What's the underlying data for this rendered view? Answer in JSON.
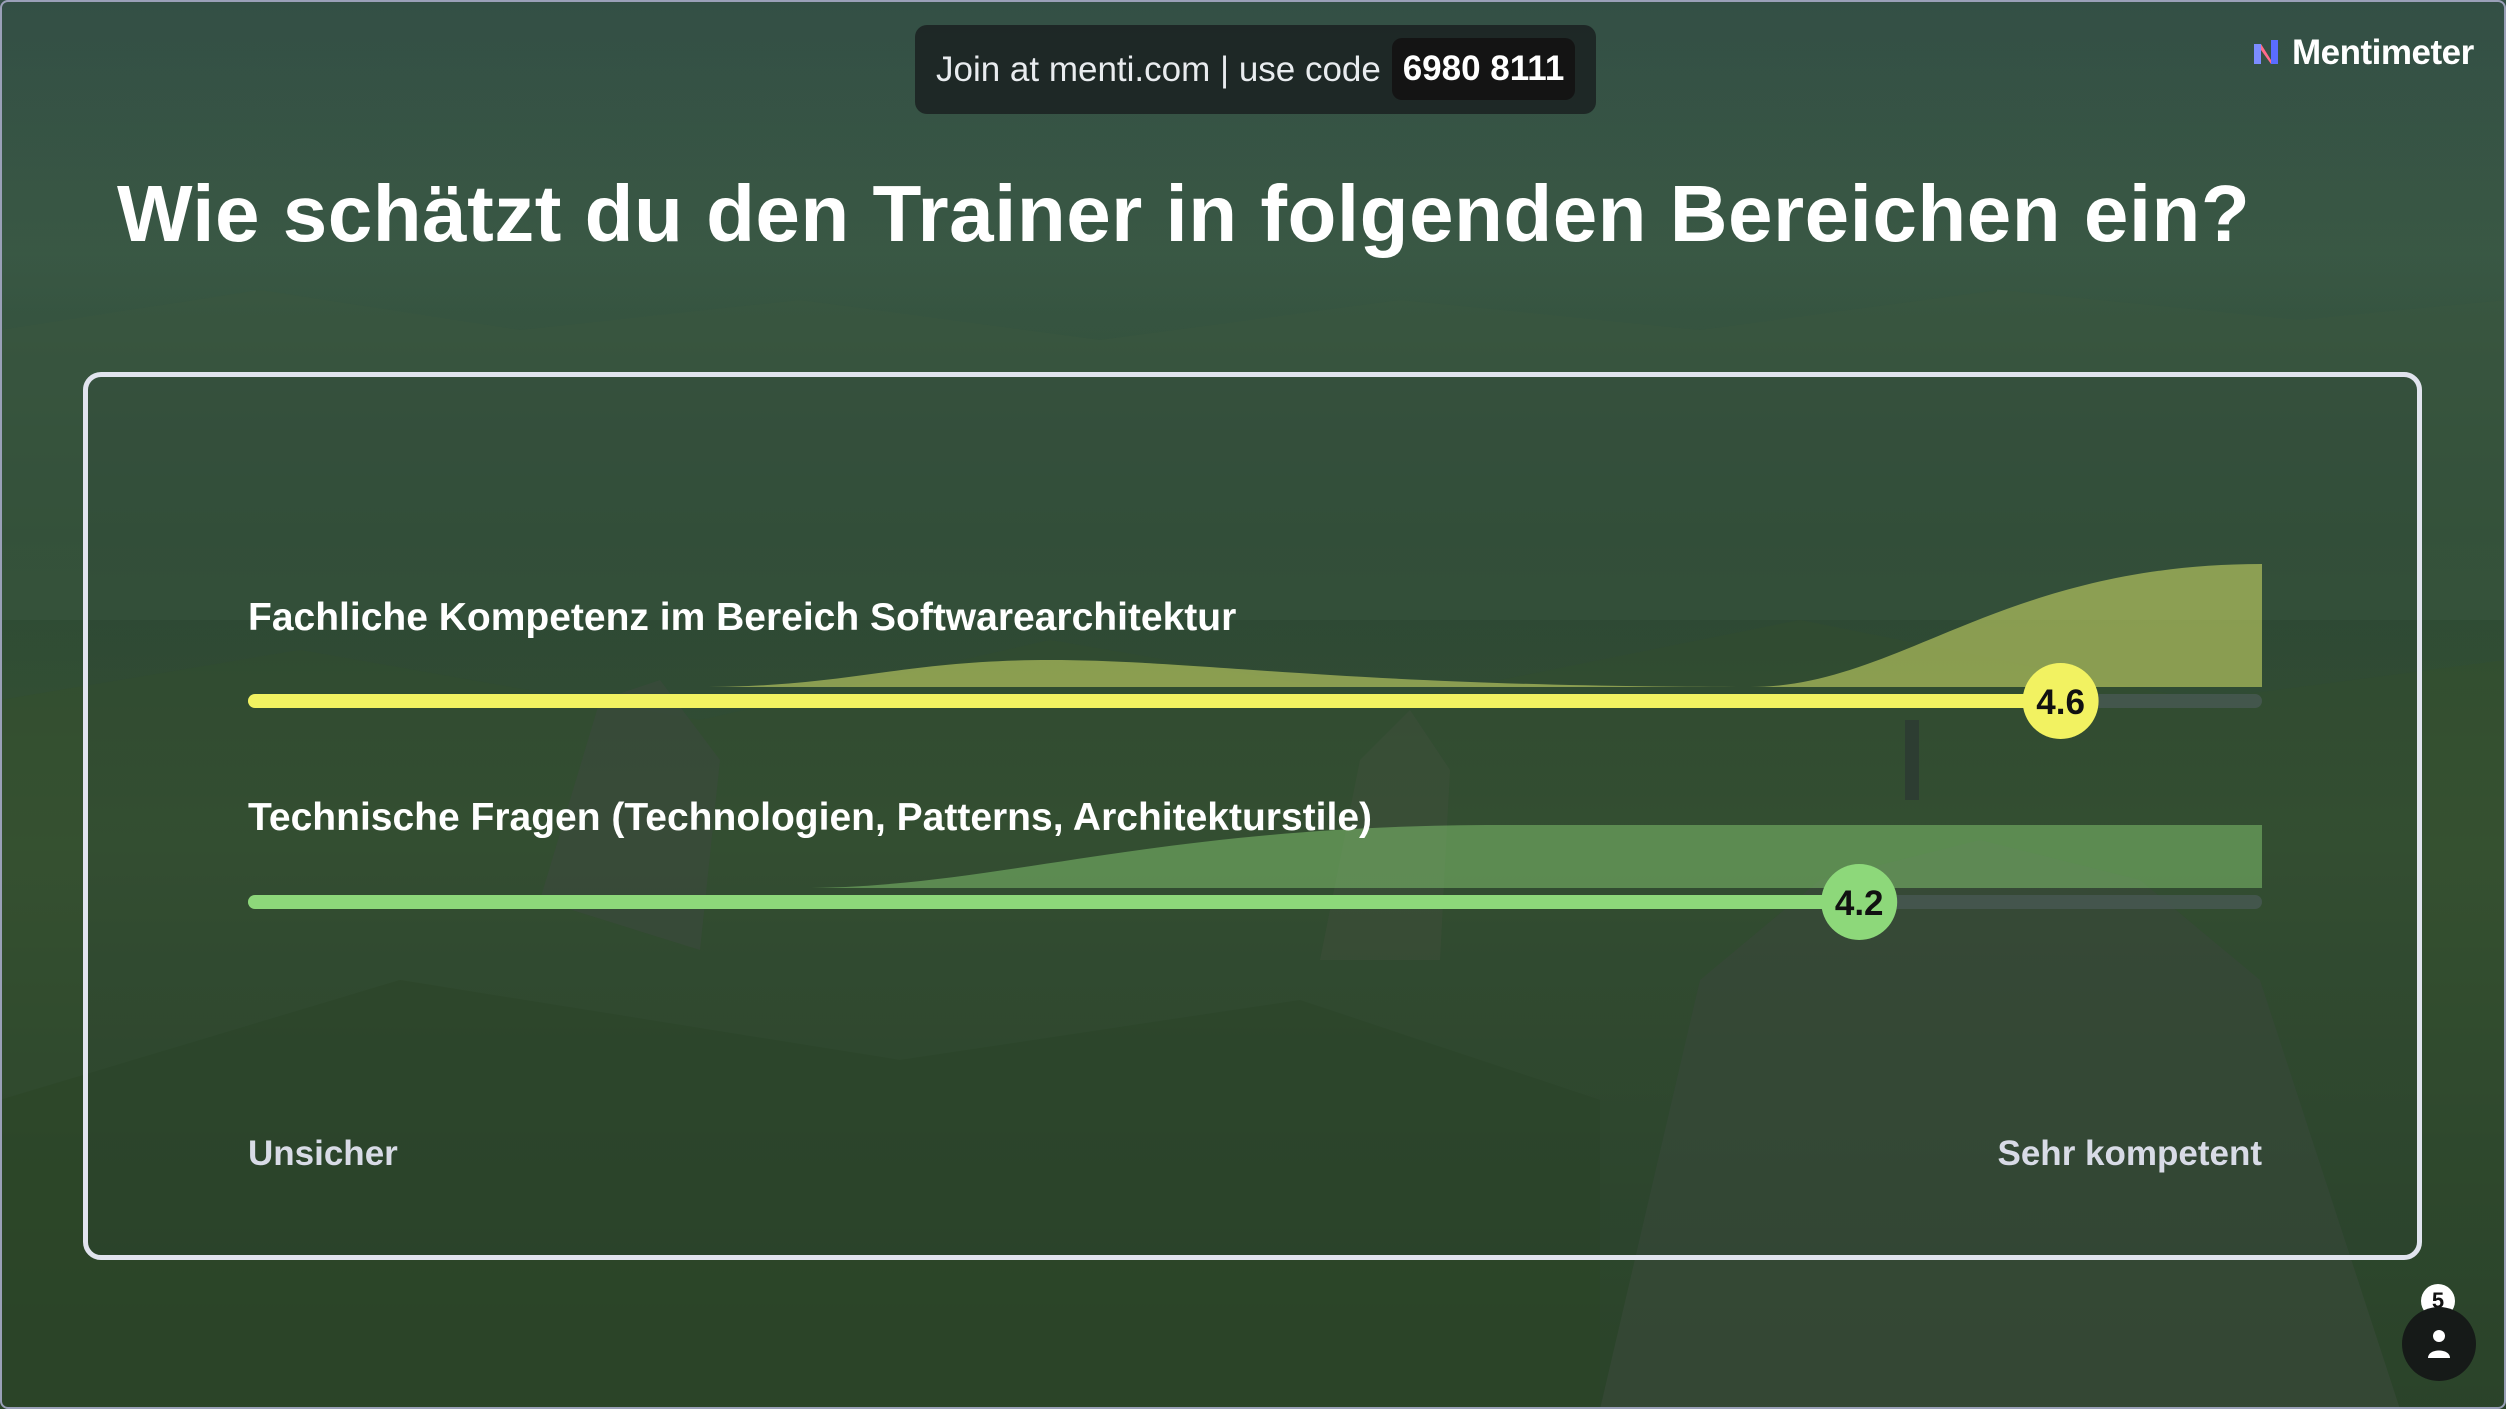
{
  "join": {
    "text": "Join at menti.com | use code",
    "code": "6980 8111"
  },
  "brand": {
    "name": "Mentimeter",
    "icon": "mentimeter-logo-icon"
  },
  "question": "Wie schätzt du den Trainer in folgenden Bereichen ein?",
  "scale": {
    "min_label": "Unsicher",
    "max_label": "Sehr kompetent",
    "min": 1,
    "max": 5
  },
  "items": [
    {
      "label": "Fachliche Kompetenz im Bereich Softwarearchitektur",
      "value_label": "4.6",
      "value": 4.6,
      "color": "#f2f261"
    },
    {
      "label": "Technische Fragen (Technologien, Patterns, Architekturstile)",
      "value_label": "4.2",
      "value": 4.2,
      "color": "#8dd87a"
    }
  ],
  "participants": {
    "count": "5",
    "icon": "person-icon"
  },
  "colors": {
    "panel_border": "#e1e4ee",
    "join_bg": "#181c1e",
    "text": "#ffffff"
  }
}
